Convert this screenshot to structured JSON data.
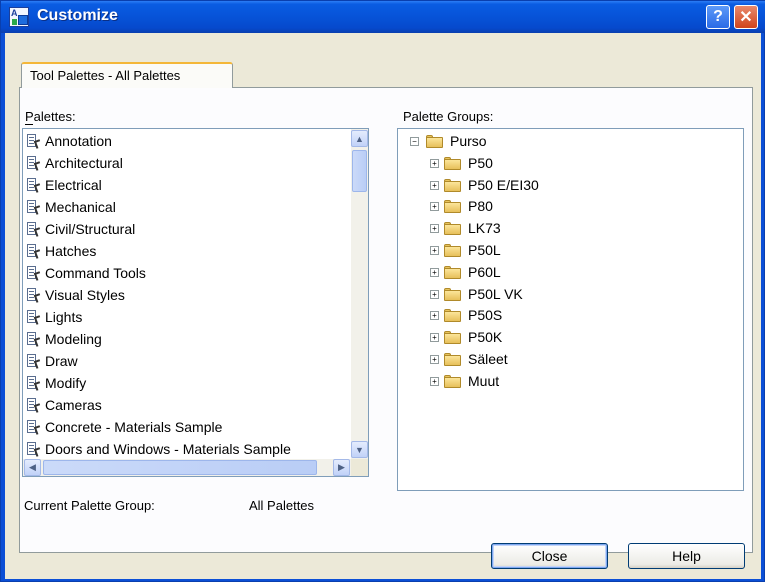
{
  "window": {
    "title": "Customize",
    "help_glyph": "?",
    "close_glyph": "✕"
  },
  "tabs": [
    {
      "label": "Tool Palettes - All Palettes",
      "selected": true
    }
  ],
  "palettes": {
    "label": "Palettes:",
    "items": [
      "Annotation",
      "Architectural",
      "Electrical",
      "Mechanical",
      "Civil/Structural",
      "Hatches",
      "Command Tools",
      "Visual Styles",
      "Lights",
      "Modeling",
      "Draw",
      "Modify",
      "Cameras",
      "Concrete - Materials Sample",
      "Doors and Windows - Materials Sample"
    ],
    "icon": "tool-palette-icon"
  },
  "palette_groups": {
    "label": "Palette Groups:",
    "root": "Purso",
    "children": [
      "P50",
      "P50 E/EI30",
      "P80",
      "LK73",
      "P50L",
      "P60L",
      "P50L VK",
      "P50S",
      "P50K",
      "Säleet",
      "Muut"
    ],
    "expand_glyph": "+",
    "collapse_glyph": "−"
  },
  "current_group": {
    "label": "Current Palette Group:",
    "value": "All Palettes"
  },
  "buttons": {
    "close": "Close",
    "help": "Help"
  },
  "scroll_glyphs": {
    "up": "▲",
    "down": "▼",
    "left": "◀",
    "right": "▶"
  },
  "colors": {
    "titlebar": "#0753d8",
    "dialog_face": "#ece9d8",
    "tab_highlight": "#f4b739",
    "close_button": "#d0441c"
  }
}
